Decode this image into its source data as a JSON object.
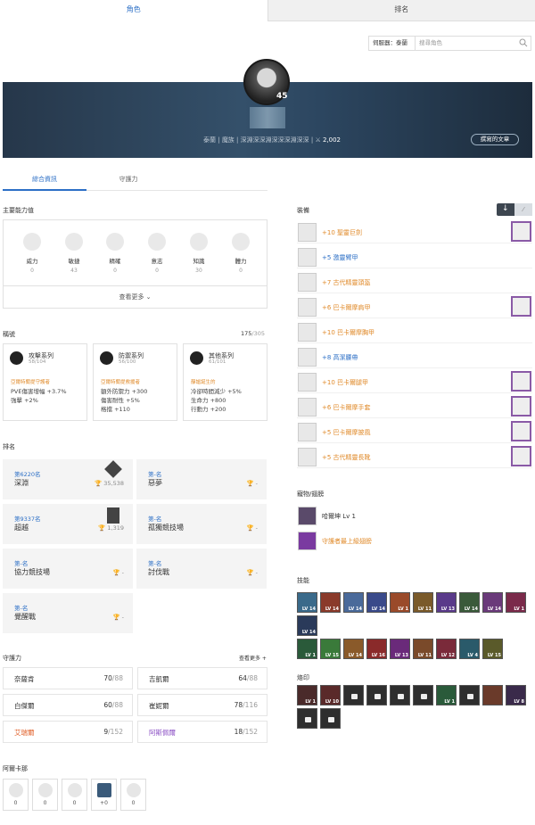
{
  "tabs": {
    "character": "角色",
    "ranking": "排名"
  },
  "search": {
    "server": "伺服器：泰蘭",
    "placeholder": "搜尋角色"
  },
  "profile": {
    "level": "45",
    "server": "泰蘭",
    "class": "魔族",
    "guild": "深淵深深淵深深深淵深深",
    "gear_score": "2,002",
    "written_posts": "撰寫的文章"
  },
  "subtabs": {
    "info": "綜合資訊",
    "guardian": "守護力"
  },
  "stats": {
    "title": "主要能力值",
    "items": [
      {
        "name": "威力",
        "value": "0"
      },
      {
        "name": "敏捷",
        "value": "43"
      },
      {
        "name": "精確",
        "value": "0"
      },
      {
        "name": "意志",
        "value": "0"
      },
      {
        "name": "知識",
        "value": "30"
      },
      {
        "name": "體力",
        "value": "0"
      }
    ],
    "more": "查看更多"
  },
  "titles": {
    "title": "稱號",
    "count": "175",
    "total": "/305",
    "cards": [
      {
        "name": "攻擊系列",
        "count": "58",
        "total": "/104",
        "owned": "亞爾特蘭提守護者",
        "effects": [
          "PVE傷害增幅 +3.7%",
          "強擊 +2%"
        ]
      },
      {
        "name": "防禦系列",
        "count": "56",
        "total": "/100",
        "owned": "亞爾特蘭提救援者",
        "effects": [
          "額外防禦力 +300",
          "傷害耐性 +5%",
          "格擋 +110"
        ]
      },
      {
        "name": "其他系列",
        "count": "61",
        "total": "/101",
        "owned": "靜謐誕生的",
        "effects": [
          "冷卻時間減少 +5%",
          "生命力 +800",
          "行動力 +200"
        ]
      }
    ]
  },
  "ranking": {
    "title": "排名",
    "items": [
      {
        "rank": "第6220名",
        "name": "深淵",
        "score": "35,538"
      },
      {
        "rank": "第-名",
        "name": "惡夢",
        "score": "-"
      },
      {
        "rank": "第9337名",
        "name": "超越",
        "score": "1,319"
      },
      {
        "rank": "第-名",
        "name": "孤獨競技場",
        "score": "-"
      },
      {
        "rank": "第-名",
        "name": "協力競技場",
        "score": "-"
      },
      {
        "rank": "第-名",
        "name": "討伐戰",
        "score": "-"
      },
      {
        "rank": "第-名",
        "name": "覺醒戰",
        "score": "-"
      }
    ]
  },
  "guardian": {
    "title": "守護力",
    "more": "查看更多",
    "items": [
      {
        "name": "奈薩肯",
        "value": "70",
        "max": "/88",
        "color": "#333333"
      },
      {
        "name": "吉凱爾",
        "value": "64",
        "max": "/88",
        "color": "#333333"
      },
      {
        "name": "白傑爾",
        "value": "60",
        "max": "/88",
        "color": "#333333"
      },
      {
        "name": "崔妮爾",
        "value": "78",
        "max": "/116",
        "color": "#333333"
      },
      {
        "name": "艾瑞爾",
        "value": "9",
        "max": "/152",
        "color": "#e0602a"
      },
      {
        "name": "阿斯佩爾",
        "value": "18",
        "max": "/152",
        "color": "#8a4fc4"
      }
    ]
  },
  "daevanion": {
    "title": "阿爾卡那",
    "values": [
      "0",
      "0",
      "0",
      "+0",
      "0"
    ]
  },
  "equipment": {
    "title": "裝備",
    "items": [
      {
        "name": "+10 聖靈巨劍",
        "color": "#e08a2a"
      },
      {
        "name": "+5 激靈臂甲",
        "color": "#2c6fc6"
      },
      {
        "name": "+7 古代精靈頭盔",
        "color": "#e08a2a"
      },
      {
        "name": "+6 巴卡爾摩肩甲",
        "color": "#e08a2a"
      },
      {
        "name": "+10 巴卡爾摩胸甲",
        "color": "#e08a2a"
      },
      {
        "name": "+8 高潔腰帶",
        "color": "#2c6fc6"
      },
      {
        "name": "+10 巴卡爾腿甲",
        "color": "#e08a2a"
      },
      {
        "name": "+6 巴卡爾摩手套",
        "color": "#e08a2a"
      },
      {
        "name": "+5 巴卡爾摩披風",
        "color": "#e08a2a"
      },
      {
        "name": "+5 古代精靈長靴",
        "color": "#e08a2a"
      }
    ]
  },
  "pets": {
    "title": "寵物/翅膀",
    "items": [
      {
        "name": "哈爾坤 Lv 1",
        "color": "#333333"
      },
      {
        "name": "守護者最上級翅膀",
        "color": "#e08a2a"
      }
    ]
  },
  "skills": {
    "title": "技能",
    "row1": [
      "LV 14",
      "LV 14",
      "LV 14",
      "LV 14",
      "LV 1",
      "LV 11",
      "LV 13",
      "LV 14",
      "LV 14",
      "LV 1"
    ],
    "row2": [
      "LV 14",
      "LV 1"
    ],
    "row3": [
      "LV 1",
      "LV 15",
      "LV 14",
      "LV 16",
      "LV 13",
      "LV 11",
      "LV 12",
      "LV 4",
      "LV 15"
    ]
  },
  "stigma": {
    "title": "烙印",
    "levels": [
      "LV 1",
      "LV 10",
      "",
      "",
      "",
      "LV 1",
      "",
      "",
      "LV 8"
    ]
  }
}
